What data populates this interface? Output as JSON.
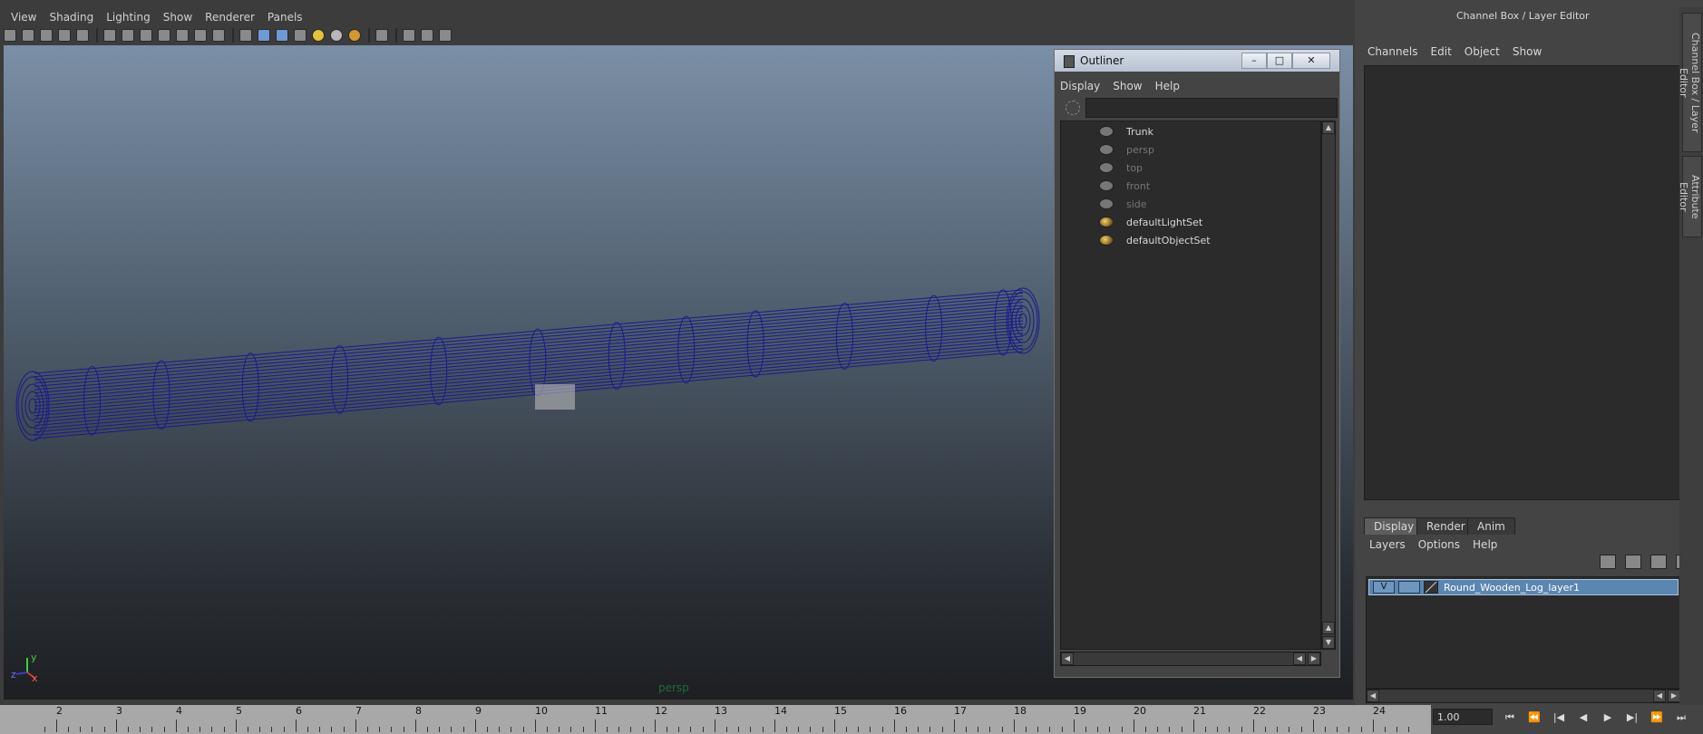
{
  "viewport": {
    "menu": [
      "View",
      "Shading",
      "Lighting",
      "Show",
      "Renderer",
      "Panels"
    ],
    "camera_label": "persp",
    "axis": {
      "x": "x",
      "y": "y",
      "z": "z"
    }
  },
  "outliner": {
    "title": "Outliner",
    "window_buttons": {
      "minimize": "–",
      "maximize": "□",
      "close": "✕"
    },
    "menu": [
      "Display",
      "Show",
      "Help"
    ],
    "search_value": "",
    "items": [
      {
        "label": "Trunk",
        "dim": false,
        "kind": "transform"
      },
      {
        "label": "persp",
        "dim": true,
        "kind": "camera"
      },
      {
        "label": "top",
        "dim": true,
        "kind": "camera"
      },
      {
        "label": "front",
        "dim": true,
        "kind": "camera"
      },
      {
        "label": "side",
        "dim": true,
        "kind": "camera"
      },
      {
        "label": "defaultLightSet",
        "dim": false,
        "kind": "set"
      },
      {
        "label": "defaultObjectSet",
        "dim": false,
        "kind": "set"
      }
    ]
  },
  "channel_box": {
    "title": "Channel Box / Layer Editor",
    "menu": [
      "Channels",
      "Edit",
      "Object",
      "Show"
    ]
  },
  "layer_editor": {
    "tabs": [
      "Display",
      "Render",
      "Anim"
    ],
    "active_tab": "Display",
    "menu": [
      "Layers",
      "Options",
      "Help"
    ],
    "layers": [
      {
        "visible": "V",
        "name": "Round_Wooden_Log_layer1"
      }
    ]
  },
  "side_tabs": [
    "Channel Box / Layer Editor",
    "Attribute Editor"
  ],
  "timeline": {
    "frames": [
      "2",
      "3",
      "4",
      "5",
      "6",
      "7",
      "8",
      "9",
      "10",
      "11",
      "12",
      "13",
      "14",
      "15",
      "16",
      "17",
      "18",
      "19",
      "20",
      "21",
      "22",
      "23",
      "24"
    ],
    "current_frame": "1.00"
  },
  "playback": {
    "buttons": [
      "⏮",
      "⏪",
      "|◀",
      "◀",
      "▶",
      "▶|",
      "⏩",
      "⏭"
    ]
  },
  "colors": {
    "wireframe": "#1a1a8a",
    "selected_layer": "#5b86b0",
    "camera_label": "#1d6d3b"
  }
}
